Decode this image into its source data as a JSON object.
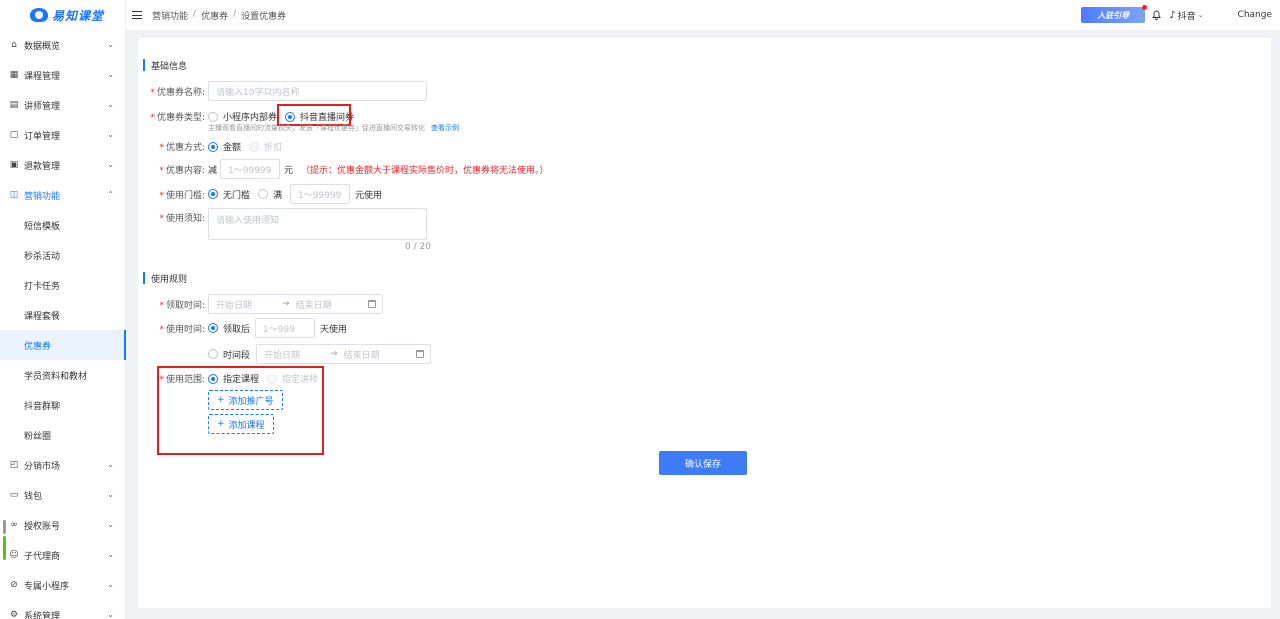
{
  "brand": {
    "name": "易知课堂",
    "color": "#1677ff"
  },
  "sidebar": {
    "items": [
      {
        "label": "数据概览",
        "icon": "home-icon"
      },
      {
        "label": "课程管理",
        "icon": "grid-icon"
      },
      {
        "label": "讲师管理",
        "icon": "id-card-icon"
      },
      {
        "label": "订单管理",
        "icon": "order-icon"
      },
      {
        "label": "退款管理",
        "icon": "refund-icon"
      },
      {
        "label": "营销功能",
        "icon": "bag-icon"
      }
    ],
    "marketing_sub": [
      "短信模板",
      "秒杀活动",
      "打卡任务",
      "课程套餐",
      "优惠券",
      "学员资料和教材",
      "抖音群聊",
      "粉丝圈"
    ],
    "items_bottom": [
      {
        "label": "分销市场",
        "icon": "store-icon"
      },
      {
        "label": "钱包",
        "icon": "wallet-icon"
      },
      {
        "label": "授权账号",
        "icon": "link-icon"
      },
      {
        "label": "子代理商",
        "icon": "users-icon"
      },
      {
        "label": "专属小程序",
        "icon": "compass-icon"
      },
      {
        "label": "系统管理",
        "icon": "gear-icon"
      }
    ]
  },
  "header": {
    "breadcrumb": [
      "营销功能",
      "优惠券",
      "设置优惠券"
    ],
    "promo": "入驻引导",
    "account": "抖音",
    "change": "Change"
  },
  "basic": {
    "title": "基础信息",
    "name_label": "优惠券名称:",
    "name_placeholder": "请输入10字以内名称",
    "type_label": "优惠券类型:",
    "type_options": [
      "小程序内部券",
      "抖音直播间券"
    ],
    "type_hint": "主播观看直播间的流量损失，发放「课程优惠券」促进直播间交易转化",
    "type_hint_link": "查看示例",
    "method_label": "优惠方式:",
    "method_options": [
      "金额",
      "折扣"
    ],
    "content_label": "优惠内容:",
    "content_prefix": "减",
    "content_placeholder": "1～99999",
    "content_unit": "元",
    "content_warn": "（提示：优惠金额大于课程实际售价时，优惠券将无法使用。）",
    "threshold_label": "使用门槛:",
    "threshold_options": [
      "无门槛",
      "满"
    ],
    "threshold_placeholder": "1～99999",
    "threshold_suffix": "元使用",
    "notice_label": "使用须知:",
    "notice_placeholder": "请输入使用须知",
    "notice_count": "0 / 20"
  },
  "rules": {
    "title": "使用规则",
    "receive_label": "领取时间:",
    "start_placeholder": "开始日期",
    "end_placeholder": "结束日期",
    "arrow": "→",
    "use_label": "使用时间:",
    "use_option1": "领取后",
    "days_placeholder": "1～999",
    "days_suffix": "天使用",
    "use_option2": "时间段",
    "scope_label": "使用范围:",
    "scope_options": [
      "指定课程",
      "指定讲师"
    ],
    "add_promoter": "添加推广号",
    "add_course": "添加课程"
  },
  "submit_label": "确认保存"
}
